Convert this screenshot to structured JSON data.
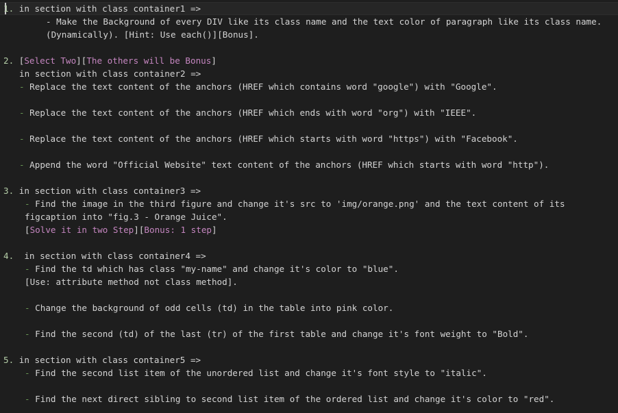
{
  "editor": {
    "line1": {
      "num": "1.",
      "text": " in section with class container1 =>"
    },
    "line2": {
      "text": "- Make the Background of every DIV like its class name and the text color of paragraph like its class name."
    },
    "line3": {
      "text": "(Dynamically). [Hint: Use each()][Bonus]."
    },
    "line4": {
      "num": "2.",
      "open": " [",
      "sel": "Select Two",
      "mid": "][",
      "others": "The others will be Bonus",
      "close": "]"
    },
    "line5": {
      "text": "in section with class container2 =>"
    },
    "line6": {
      "dash": "-",
      "text": " Replace the text content of the anchors (HREF which contains word \"google\") with \"Google\"."
    },
    "line7": {
      "dash": "-",
      "text": " Replace the text content of the anchors (HREF which ends with word \"org\") with \"IEEE\"."
    },
    "line8": {
      "dash": "-",
      "text": " Replace the text content of the anchors (HREF which starts with word \"https\") with \"Facebook\"."
    },
    "line9": {
      "dash": "-",
      "text": " Append the word \"Official Website\" text content of the anchors (HREF which starts with word \"http\")."
    },
    "line10": {
      "num": "3.",
      "text": " in section with class container3 =>"
    },
    "line11": {
      "dash": "-",
      "text": " Find the image in the third figure and change it's src to 'img/orange.png' and the text content of its"
    },
    "line12": {
      "text": "figcaption into \"fig.3 - Orange Juice\"."
    },
    "line13": {
      "open": "[",
      "solve": "Solve it in two Step",
      "mid": "][",
      "bonus": "Bonus: 1 step",
      "close": "]"
    },
    "line14": {
      "num": "4.",
      "text": "  in section with class container4 =>"
    },
    "line15": {
      "dash": "-",
      "text": " Find the td which has class \"my-name\" and change it's color to \"blue\"."
    },
    "line16": {
      "text": "[Use: attribute method not class method]."
    },
    "line17": {
      "dash": "-",
      "text": " Change the background of odd cells (td) in the table into pink color."
    },
    "line18": {
      "dash": "-",
      "text": " Find the second (td) of the last (tr) of the first table and change it's font weight to \"Bold\"."
    },
    "line19": {
      "num": "5.",
      "text": " in section with class container5 =>"
    },
    "line20": {
      "dash": "-",
      "text": " Find the second list item of the unordered list and change it's font style to \"italic\"."
    },
    "line21": {
      "dash": "-",
      "text": " Find the next direct sibling to second list item of the ordered list and change it's color to \"red\"."
    }
  },
  "colors": {
    "background": "#1e1e1e",
    "text": "#d4d4d4",
    "number": "#b5cea8",
    "highlight": "#c586c0",
    "bullet": "#6a9955"
  }
}
